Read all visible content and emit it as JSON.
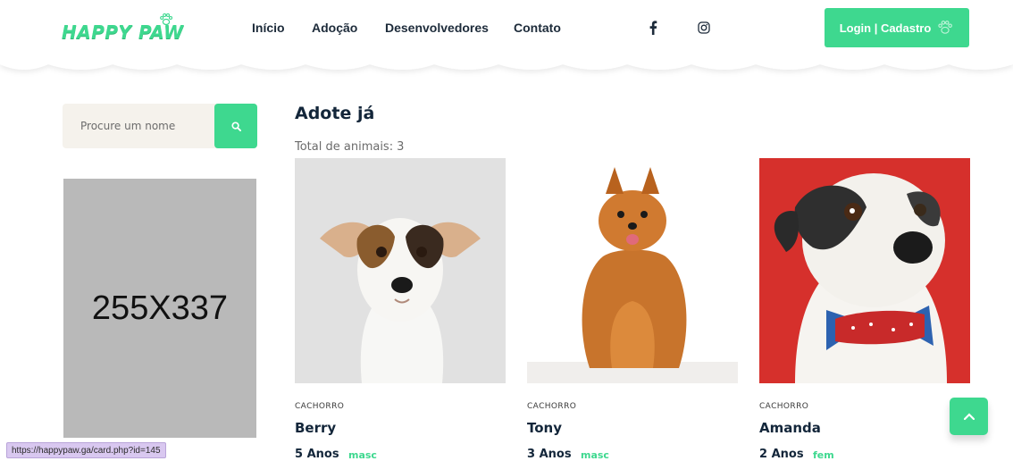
{
  "header": {
    "logo": "HAPPY PAW",
    "nav": [
      "Início",
      "Adoção",
      "Desenvolvedores",
      "Contato"
    ],
    "login_label": "Login | Cadastro",
    "social_icons": [
      "facebook-icon",
      "instagram-icon"
    ]
  },
  "sidebar": {
    "search_placeholder": "Procure um nome",
    "ad_placeholder": "255X337"
  },
  "main": {
    "title": "Adote já",
    "total_label": "Total de animais:",
    "total_count": "3",
    "cards": [
      {
        "species": "CACHORRO",
        "name": "Berry",
        "age": "5 Anos",
        "sex": "masc",
        "bg": "#e3e3e3"
      },
      {
        "species": "CACHORRO",
        "name": "Tony",
        "age": "3 Anos",
        "sex": "masc",
        "bg": "#ffffff"
      },
      {
        "species": "CACHORRO",
        "name": "Amanda",
        "age": "2 Anos",
        "sex": "fem",
        "bg": "#d62d2d"
      }
    ]
  },
  "status_bar": {
    "url": "https://happypaw.ga/card.php?id=145"
  },
  "colors": {
    "accent": "#3ed88f",
    "heading": "#13263a",
    "search_bg": "#f5f2ec",
    "placeholder_bg": "#b9b9b9"
  }
}
